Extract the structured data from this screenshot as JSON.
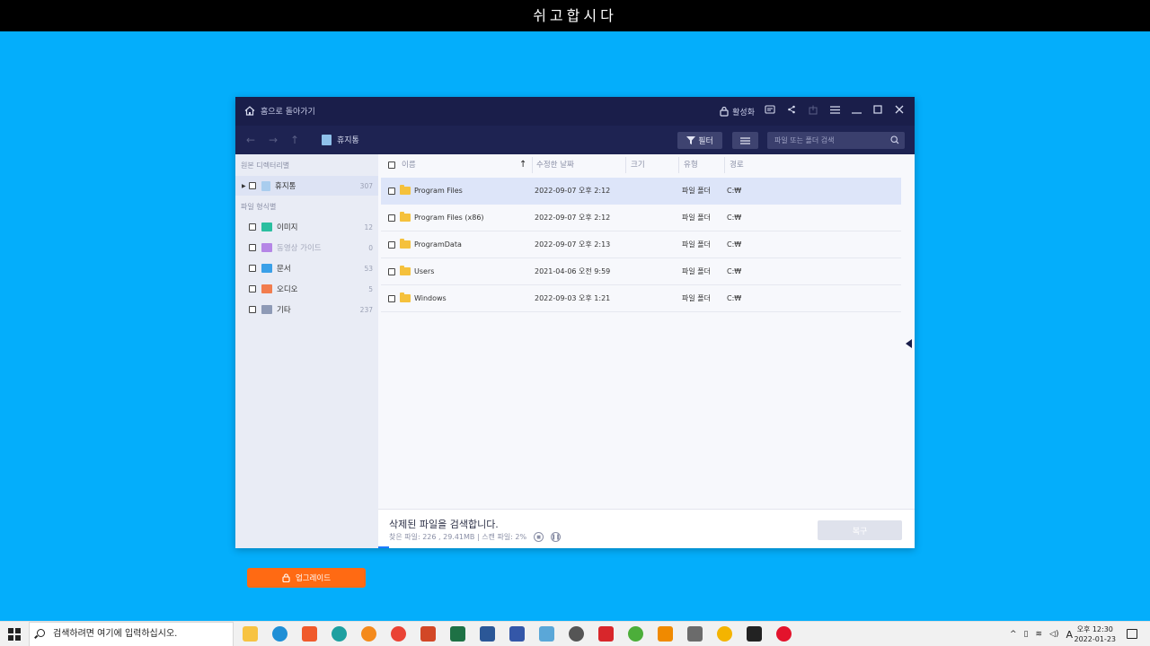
{
  "banner": {
    "text": "쉬고합시다"
  },
  "titlebar": {
    "home_label": "홈으로 돌아가기",
    "activate_label": "활성화"
  },
  "navbar": {
    "crumb": "휴지통",
    "filter_label": "필터",
    "search_placeholder": "파일 또는 폴더 검색"
  },
  "sidebar": {
    "section_path": "원본 디렉터리별",
    "section_type": "파일 형식별",
    "path_items": [
      {
        "label": "휴지통",
        "count": "307"
      }
    ],
    "type_items": [
      {
        "label": "이미지",
        "count": "12",
        "color": "#2bbfa0"
      },
      {
        "label": "동영상 가이드",
        "count": "0",
        "color": "#b586e6"
      },
      {
        "label": "문서",
        "count": "53",
        "color": "#3aa0e8"
      },
      {
        "label": "오디오",
        "count": "5",
        "color": "#f27d4e"
      },
      {
        "label": "기타",
        "count": "237",
        "color": "#8e9ab6"
      }
    ],
    "upgrade_label": "업그레이드"
  },
  "table": {
    "columns": {
      "name": "이름",
      "modified": "수정한 날짜",
      "size": "크기",
      "type": "유형",
      "path": "경로"
    },
    "rows": [
      {
        "name": "Program Files",
        "modified": "2022-09-07 오후 2:12",
        "size": "",
        "type": "파일 폴더",
        "path": "C:₩"
      },
      {
        "name": "Program Files (x86)",
        "modified": "2022-09-07 오후 2:12",
        "size": "",
        "type": "파일 폴더",
        "path": "C:₩"
      },
      {
        "name": "ProgramData",
        "modified": "2022-09-07 오후 2:13",
        "size": "",
        "type": "파일 폴더",
        "path": "C:₩"
      },
      {
        "name": "Users",
        "modified": "2021-04-06 오전 9:59",
        "size": "",
        "type": "파일 폴더",
        "path": "C:₩"
      },
      {
        "name": "Windows",
        "modified": "2022-09-03 오후 1:21",
        "size": "",
        "type": "파일 폴더",
        "path": "C:₩"
      }
    ]
  },
  "status": {
    "main": "삭제된 파일을 검색합니다.",
    "sub": "찾은 파일: 226 , 29.41MB | 스캔 파일: 2%",
    "restore_label": "복구"
  },
  "taskbar": {
    "search_placeholder": "검색하려면 여기에 입력하십시오.",
    "ime": "A",
    "time": "오후 12:30",
    "date": "2022-01-23"
  },
  "colors": {
    "accent": "#ff6a13",
    "titlebar": "#1a1e4a",
    "desktop": "#04aefb"
  }
}
